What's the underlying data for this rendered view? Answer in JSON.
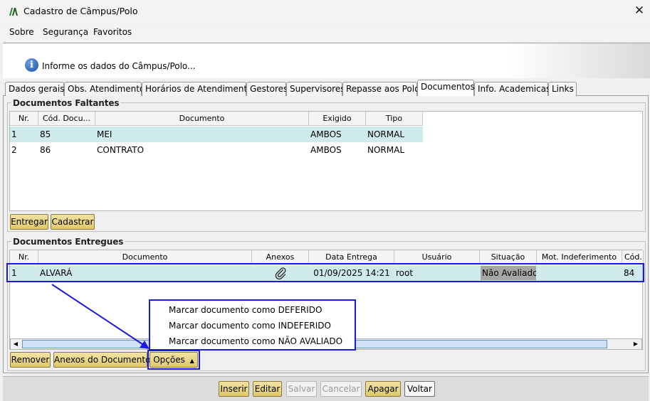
{
  "window": {
    "title": "Cadastro de Câmpus/Polo",
    "close_glyph": "✕"
  },
  "menu": [
    {
      "label": "Sobre"
    },
    {
      "label": "Segurança"
    },
    {
      "label": "Favoritos"
    }
  ],
  "banner": {
    "icon": "info-icon",
    "text": "Informe os dados do Câmpus/Polo..."
  },
  "tabs": [
    {
      "label": "Dados gerais",
      "active": false
    },
    {
      "label": "Obs. Atendimento",
      "active": false
    },
    {
      "label": "Horários de Atendimento",
      "active": false
    },
    {
      "label": "Gestores",
      "active": false
    },
    {
      "label": "Supervisores",
      "active": false
    },
    {
      "label": "Repasse aos Polos",
      "active": false
    },
    {
      "label": "Documentos",
      "active": true
    },
    {
      "label": "Info. Academicas",
      "active": false
    },
    {
      "label": "Links",
      "active": false
    }
  ],
  "faltantes": {
    "title": "Documentos Faltantes",
    "columns": [
      "Nr.",
      "Cód. Docu...",
      "Documento",
      "Exigido",
      "Tipo"
    ],
    "rows": [
      {
        "nr": "1",
        "cod": "85",
        "documento": "MEI",
        "exigido": "AMBOS",
        "tipo": "NORMAL",
        "selected": true
      },
      {
        "nr": "2",
        "cod": "86",
        "documento": "CONTRATO",
        "exigido": "AMBOS",
        "tipo": "NORMAL",
        "selected": false
      }
    ],
    "buttons": {
      "entregar": "Entregar",
      "cadastrar": "Cadastrar"
    }
  },
  "entregues": {
    "title": "Documentos Entregues",
    "columns": [
      "Nr.",
      "Documento",
      "Anexos",
      "Data Entrega",
      "Usuário",
      "Situação",
      "Mot. Indeferimento",
      "Cód."
    ],
    "rows": [
      {
        "nr": "1",
        "documento": "ALVARÁ",
        "anexos_icon": "paperclip-icon",
        "data": "01/09/2025 14:21",
        "usuario": "root",
        "situacao": "Não Avaliado",
        "motivo": "",
        "cod": "84"
      }
    ],
    "buttons": {
      "remover": "Remover",
      "anexos": "Anexos do Documento",
      "opcoes": "Opções"
    }
  },
  "popup_menu": [
    {
      "label": "Marcar documento como DEFERIDO"
    },
    {
      "label": "Marcar documento como INDEFERIDO"
    },
    {
      "label": "Marcar documento como NÃO AVALIADO"
    }
  ],
  "toolbar": {
    "inserir": "Inserir",
    "editar": "Editar",
    "salvar": "Salvar",
    "cancelar": "Cancelar",
    "apagar": "Apagar",
    "voltar": "Voltar"
  },
  "colors": {
    "selected_row": "#cfeaea",
    "highlight": "#1a1ae0",
    "button": "#e9d68a",
    "status_cell": "#a6a6a6"
  }
}
